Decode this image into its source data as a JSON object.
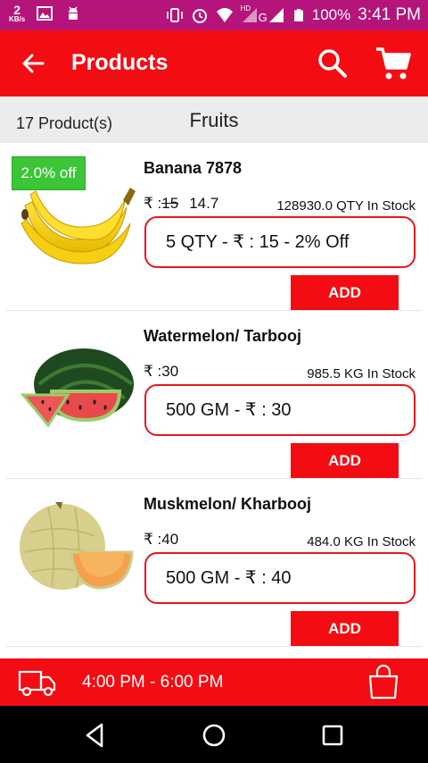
{
  "status_bar": {
    "net_speed": "2",
    "net_speed_unit": "KB/s",
    "network": "G",
    "hd_label": "HD",
    "battery": "100%",
    "time": "3:41 PM"
  },
  "app_bar": {
    "title": "Products"
  },
  "subheader": {
    "count": "17 Product(s)",
    "category": "Fruits"
  },
  "products": [
    {
      "name": "Banana 7878",
      "discount_badge": "2.0% off",
      "price_prefix": "₹ :",
      "old_price": "15",
      "new_price": "14.7",
      "stock": "128930.0 QTY In Stock",
      "variant": "5 QTY - ₹ : 15 - 2% Off",
      "add_label": "ADD"
    },
    {
      "name": "Watermelon/ Tarbooj",
      "price": "₹ :30",
      "stock": "985.5 KG In Stock",
      "variant": "500 GM - ₹ : 30",
      "add_label": "ADD"
    },
    {
      "name": "Muskmelon/ Kharbooj",
      "price": "₹ :40",
      "stock": "484.0 KG In Stock",
      "variant": "500 GM - ₹ : 40",
      "add_label": "ADD"
    }
  ],
  "bottom_bar": {
    "delivery_slot": "4:00 PM - 6:00 PM"
  },
  "icons": {
    "back": "arrow-left-icon",
    "search": "search-icon",
    "cart": "cart-icon",
    "truck": "delivery-truck-icon",
    "bag": "shopping-bag-icon"
  },
  "colors": {
    "status_bar": "#b5147a",
    "brand_red": "#f40c13",
    "discount_green": "#3cc537",
    "subheader_bg": "#ececec"
  }
}
